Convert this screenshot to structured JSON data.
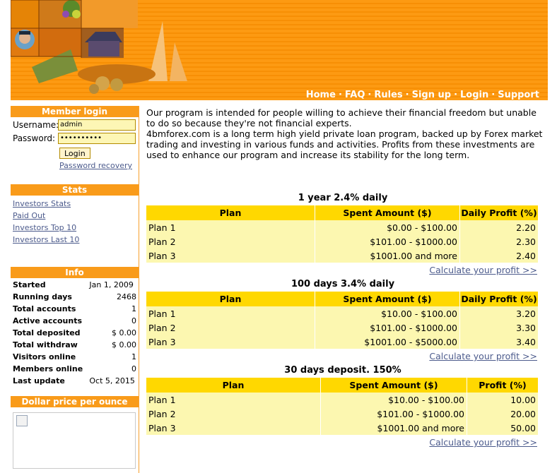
{
  "nav": {
    "items": [
      "Home",
      "FAQ",
      "Rules",
      "Sign up",
      "Login",
      "Support"
    ],
    "separator": "·"
  },
  "member_login": {
    "title": "Member login",
    "username_label": "Username:",
    "username_value": "admin",
    "password_label": "Password:",
    "password_value": "••••••••••",
    "login_button": "Login",
    "recovery_link": "Password recovery"
  },
  "stats": {
    "title": "Stats",
    "links": [
      "Investors Stats",
      "Paid Out",
      "Investors Top 10",
      "Investors Last 10"
    ]
  },
  "info": {
    "title": "Info",
    "rows": [
      {
        "label": "Started",
        "value": "Jan 1, 2009"
      },
      {
        "label": "Running days",
        "value": "2468"
      },
      {
        "label": "Total accounts",
        "value": "1"
      },
      {
        "label": "Active accounts",
        "value": "0"
      },
      {
        "label": "Total deposited",
        "value": "$ 0.00"
      },
      {
        "label": "Total withdraw",
        "value": "$ 0.00"
      },
      {
        "label": "Visitors online",
        "value": "1"
      },
      {
        "label": "Members online",
        "value": "0"
      },
      {
        "label": "Last update",
        "value": "Oct 5, 2015"
      }
    ]
  },
  "dollar_price": {
    "title": "Dollar price per ounce"
  },
  "intro": {
    "p1": "Our program is intended for people willing to achieve their financial freedom but unable to do so because they're not financial experts.",
    "p2": "4bmforex.com is a long term high yield private loan program, backed up by Forex market trading and investing in various funds and activities. Profits from these investments are used to enhance our program and increase its stability for the long term."
  },
  "plans": [
    {
      "title": "1 year 2.4% daily",
      "headers": [
        "Plan",
        "Spent Amount ($)",
        "Daily Profit (%)"
      ],
      "rows": [
        [
          "Plan 1",
          "$0.00 - $100.00",
          "2.20"
        ],
        [
          "Plan 2",
          "$101.00 - $1000.00",
          "2.30"
        ],
        [
          "Plan 3",
          "$1001.00 and more",
          "2.40"
        ]
      ],
      "calc_link": "Calculate your profit >>"
    },
    {
      "title": "100 days 3.4% daily",
      "headers": [
        "Plan",
        "Spent Amount ($)",
        "Daily Profit (%)"
      ],
      "rows": [
        [
          "Plan 1",
          "$10.00 - $100.00",
          "3.20"
        ],
        [
          "Plan 2",
          "$101.00 - $1000.00",
          "3.30"
        ],
        [
          "Plan 3",
          "$1001.00 - $5000.00",
          "3.40"
        ]
      ],
      "calc_link": "Calculate your profit >>"
    },
    {
      "title": "30 days deposit. 150%",
      "headers": [
        "Plan",
        "Spent Amount ($)",
        "Profit (%)"
      ],
      "rows": [
        [
          "Plan 1",
          "$10.00 - $100.00",
          "10.00"
        ],
        [
          "Plan 2",
          "$101.00 - $1000.00",
          "20.00"
        ],
        [
          "Plan 3",
          "$1001.00 and more",
          "50.00"
        ]
      ],
      "calc_link": "Calculate your profit >>"
    }
  ],
  "colors": {
    "header_orange": "#fd9a12",
    "section_header": "#f99b1a",
    "table_header": "#ffd800",
    "table_row": "#fcf7b0",
    "link": "#4c5b8c"
  }
}
